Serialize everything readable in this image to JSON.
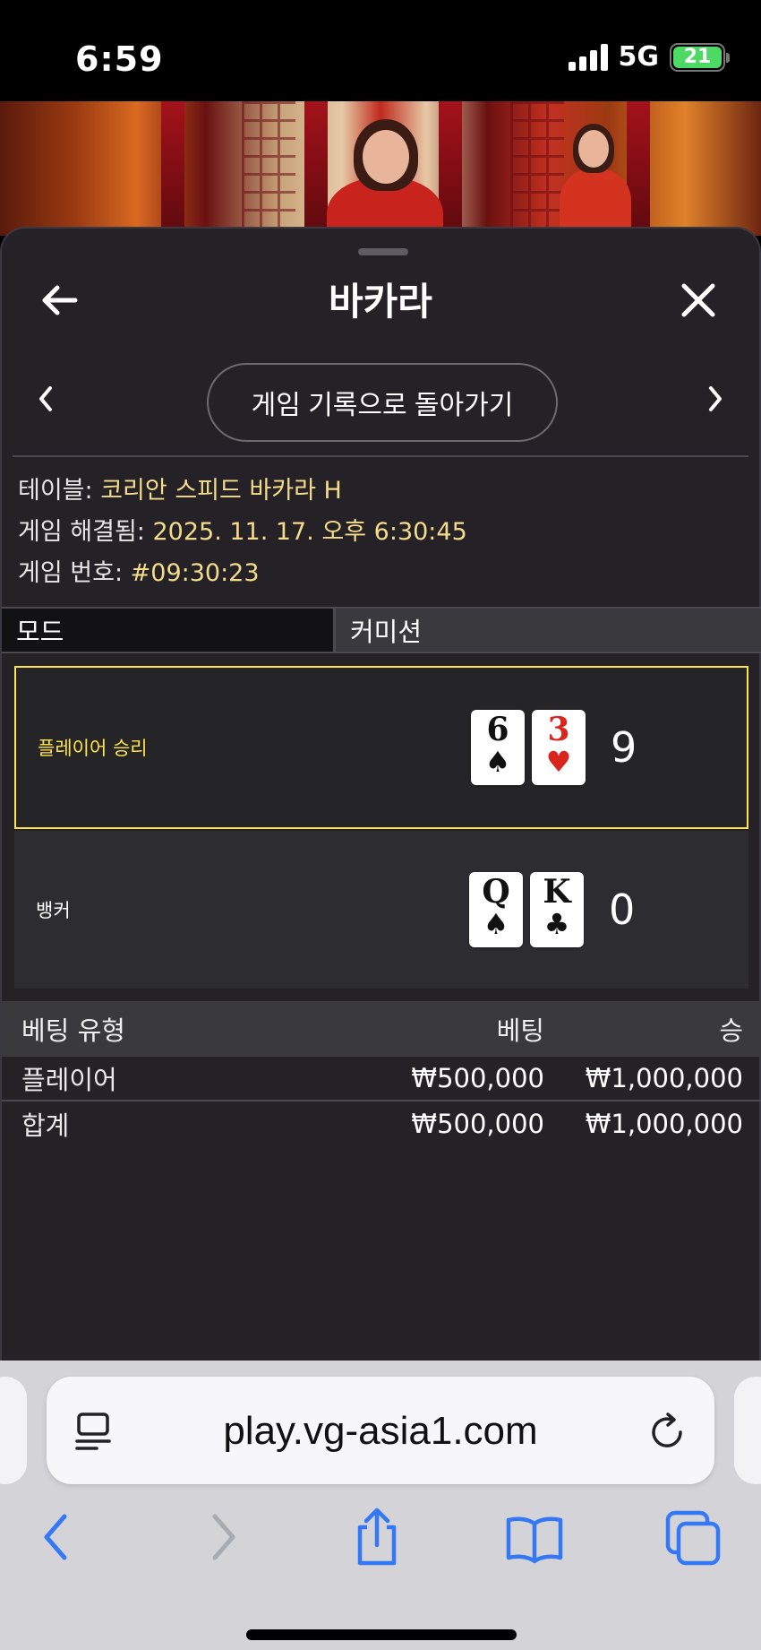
{
  "status_bar": {
    "time": "6:59",
    "network": "5G",
    "battery": "21"
  },
  "header": {
    "title": "바카라"
  },
  "nav": {
    "back_to_history": "게임 기록으로 돌아가기"
  },
  "info": {
    "table_label": "테이블:",
    "table_value": "코리안 스피드 바카라 H",
    "resolved_label": "게임 해결됨:",
    "resolved_value": "2025. 11. 17. 오후 6:30:45",
    "game_no_label": "게임 번호:",
    "game_no_value": "#09:30:23"
  },
  "tabs": {
    "mode": "모드",
    "commission": "커미션"
  },
  "results": {
    "player": {
      "label": "플레이어 승리",
      "cards": [
        {
          "rank": "6",
          "suit": "♠",
          "color": "#111111"
        },
        {
          "rank": "3",
          "suit": "♥",
          "color": "#d8261f"
        }
      ],
      "score": "9"
    },
    "banker": {
      "label": "뱅커",
      "cards": [
        {
          "rank": "Q",
          "suit": "♠",
          "color": "#111111"
        },
        {
          "rank": "K",
          "suit": "♣",
          "color": "#111111"
        }
      ],
      "score": "0"
    }
  },
  "bets": {
    "headers": {
      "type": "베팅 유형",
      "bet": "베팅",
      "win": "승"
    },
    "rows": [
      {
        "type": "플레이어",
        "bet": "₩500,000",
        "win": "₩1,000,000"
      }
    ],
    "total": {
      "type": "합계",
      "bet": "₩500,000",
      "win": "₩1,000,000"
    }
  },
  "browser": {
    "url": "play.vg-asia1.com"
  },
  "colors": {
    "accent": "#ffe44d",
    "info_value": "#f4dc8a",
    "ios_blue": "#3478f6"
  }
}
